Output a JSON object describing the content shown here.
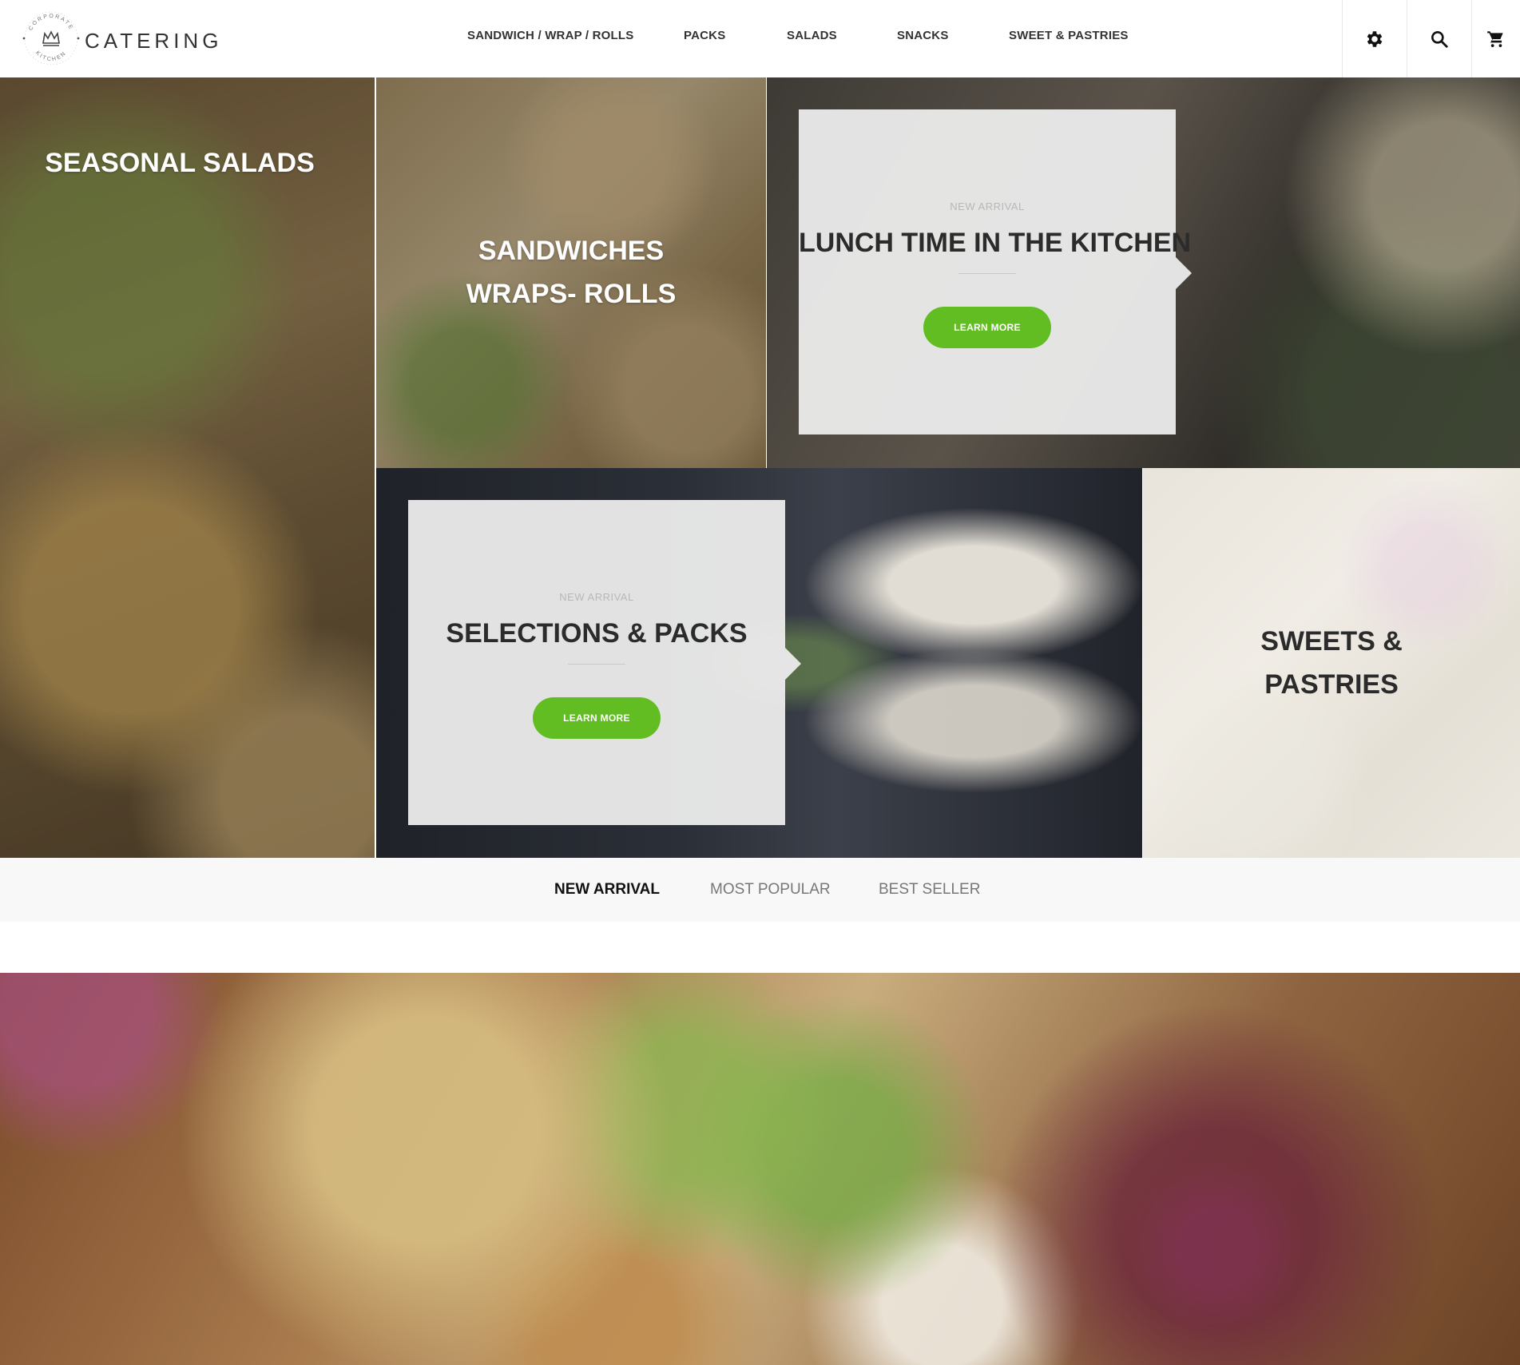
{
  "brand": {
    "seal_text": "CORPORATE KITCHEN",
    "name": "CATERING"
  },
  "nav": {
    "items": [
      {
        "label": "SANDWICH / WRAP / ROLLS"
      },
      {
        "label": "PACKS"
      },
      {
        "label": "SALADS"
      },
      {
        "label": "SNACKS"
      },
      {
        "label": "SWEET & PASTRIES"
      }
    ]
  },
  "header_icons": {
    "settings": "gear-icon",
    "search": "search-icon",
    "cart": "cart-icon"
  },
  "tiles": {
    "salads": {
      "title": "SEASONAL SALADS"
    },
    "sandwiches": {
      "title_line1": "SANDWICHES",
      "title_line2": "WRAPS- ROLLS"
    },
    "lunch": {
      "eyebrow": "NEW ARRIVAL",
      "title": "LUNCH TIME IN THE KITCHEN",
      "button": "LEARN MORE"
    },
    "packs": {
      "eyebrow": "NEW ARRIVAL",
      "title": "SELECTIONS & PACKS",
      "button": "LEARN MORE"
    },
    "sweets": {
      "title_line1": "SWEETS &",
      "title_line2": "PASTRIES"
    }
  },
  "tabs": [
    {
      "label": "NEW ARRIVAL",
      "active": true
    },
    {
      "label": "MOST POPULAR",
      "active": false
    },
    {
      "label": "BEST SELLER",
      "active": false
    }
  ],
  "colors": {
    "accent_green": "#62bd22",
    "text_dark": "#2b2b2b",
    "tab_bar": "#f8f8f8"
  }
}
